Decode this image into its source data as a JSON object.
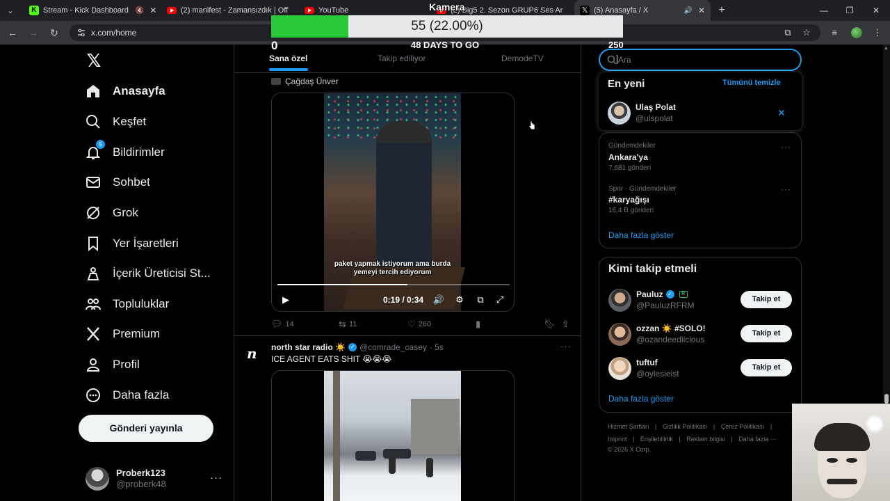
{
  "browser": {
    "tabs": [
      {
        "title": "Stream - Kick Dashboard",
        "favicon": "kick-icon"
      },
      {
        "title": "(2) manifest - Zamansızdık | Off",
        "favicon": "youtube-icon"
      },
      {
        "title": "YouTube",
        "favicon": "youtube-icon"
      },
      {
        "title": "(2) Big5 2. Sezon GRUP6 Ses Ar",
        "favicon": "youtube-icon"
      },
      {
        "title": "(5) Anasayfa / X",
        "favicon": "x-icon",
        "active": true
      }
    ],
    "url": "x.com/home"
  },
  "overlay": {
    "camera_label": "Kamera",
    "goal_text": "55 (22.00%)",
    "goal_progress": 0.22,
    "goal_min": "0",
    "goal_days": "48 DAYS TO GO",
    "goal_max": "250",
    "fill_color": "#28c83a"
  },
  "sidebar": {
    "items": [
      {
        "label": "Anasayfa",
        "icon": "home-icon"
      },
      {
        "label": "Keşfet",
        "icon": "search-icon"
      },
      {
        "label": "Bildirimler",
        "icon": "bell-icon",
        "badge": "5"
      },
      {
        "label": "Sohbet",
        "icon": "mail-icon"
      },
      {
        "label": "Grok",
        "icon": "grok-icon"
      },
      {
        "label": "Yer İşaretleri",
        "icon": "bookmark-icon"
      },
      {
        "label": "İçerik Üreticisi St...",
        "icon": "creator-studio-icon"
      },
      {
        "label": "Topluluklar",
        "icon": "communities-icon"
      },
      {
        "label": "Premium",
        "icon": "x-premium-icon"
      },
      {
        "label": "Profil",
        "icon": "profile-icon"
      },
      {
        "label": "Daha fazla",
        "icon": "more-circle-icon"
      }
    ],
    "post_button": "Gönderi yayınla",
    "account": {
      "name": "Proberk123",
      "handle": "@proberk48"
    }
  },
  "feed": {
    "tabs": [
      "Sana özel",
      "Takip ediliyor",
      "DemodeTV"
    ],
    "active_tab": "Sana özel",
    "tweet1": {
      "reposter": "Çağdaş Ünver",
      "video_caption": "paket yapmak istiyorum ama burda yemeyi tercih ediyorum",
      "time": "0:19 / 0:34",
      "progress": 0.56,
      "replies": "14",
      "reposts": "11",
      "likes": "260"
    },
    "tweet2": {
      "name": "north star radio ☀️",
      "handle": "@comrade_casey",
      "time": "· 5s",
      "text": "ICE AGENT EATS SHIT 😭😭😭"
    }
  },
  "search": {
    "placeholder": "Ara",
    "recent_title": "En yeni",
    "clear_all": "Tümünü temizle",
    "recent_user": {
      "name": "Ulaş Polat",
      "handle": "@ulspolat"
    }
  },
  "trends": {
    "items": [
      {
        "category": "Gündemdekiler",
        "name": "Ankara'ya",
        "count": "7.681 gönderi"
      },
      {
        "category": "Spor · Gündemdekiler",
        "name": "#karyağışı",
        "count": "16,4 B gönderi"
      }
    ],
    "show_more": "Daha fazla göster"
  },
  "who_to_follow": {
    "title": "Kimi takip etmeli",
    "users": [
      {
        "name": "Pauluz",
        "handle": "@PauluzRFRM",
        "verified": true,
        "sub_badge": "R"
      },
      {
        "name": "ozzan ☀️ #SOLO!",
        "handle": "@ozandeedlicious"
      },
      {
        "name": "tuftuf",
        "handle": "@oylesieist"
      }
    ],
    "follow_label": "Takip et",
    "show_more": "Daha fazla göster"
  },
  "footer": {
    "links": [
      "Hizmet Şartları",
      "Gizlilik Politikası",
      "Çerez Politikası",
      "Imprint",
      "Erişilebilirlik",
      "Reklam bilgisi",
      "Daha fazla ···"
    ],
    "copyright": "© 2026 X Corp."
  },
  "colors": {
    "accent": "#1d9bf0",
    "background": "#000000",
    "border": "#2f3336"
  }
}
